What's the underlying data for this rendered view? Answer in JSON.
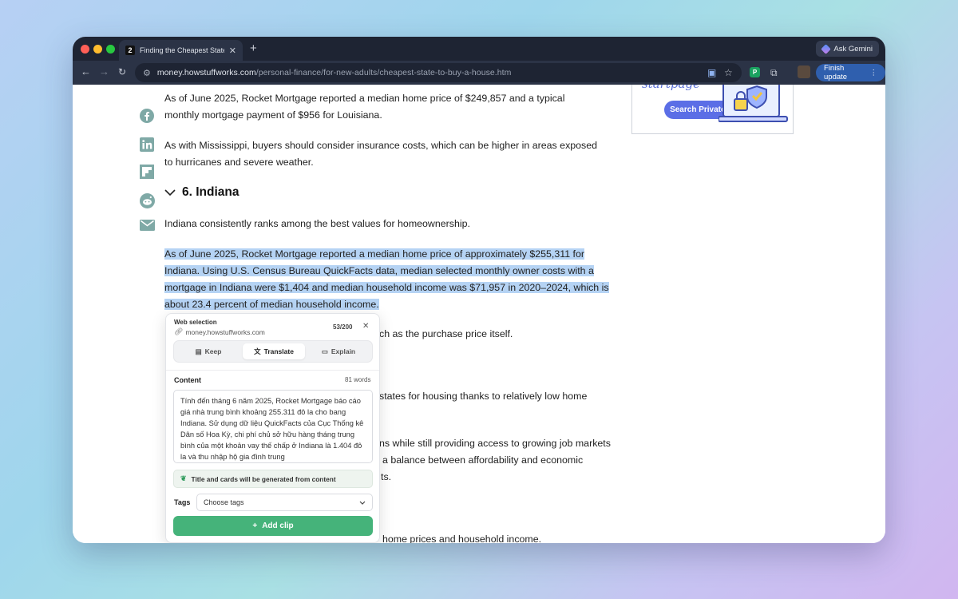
{
  "browser": {
    "tab_title": "Finding the Cheapest State to Buy a House",
    "tab_favicon_letter": "2",
    "url_domain": "money.howstuffworks.com",
    "url_path": "/personal-finance/for-new-adults/cheapest-state-to-buy-a-house.htm",
    "ask_gemini_label": "Ask Gemini",
    "finish_update_label": "Finish update",
    "extension_letter": "P"
  },
  "ad": {
    "brand": "startpage",
    "button_label": "Search Privately"
  },
  "article": {
    "p1": "As of June 2025, Rocket Mortgage reported a median home price of $249,857 and a typical monthly mortgage payment of $956 for Louisiana.",
    "p2": "As with Mississippi, buyers should consider insurance costs, which can be higher in areas exposed to hurricanes and severe weather.",
    "section_heading": "6. Indiana",
    "p3": "Indiana consistently ranks among the best values for homeownership.",
    "selected_lines": [
      "As of June 2025, Rocket Mortgage reported a median home price of approximately $255,311 for",
      "Indiana. Using U.S. Census Bureau QuickFacts data, median selected monthly owner costs with a",
      "mortgage in Indiana were $1,404 and median household income was $71,957 in 2020–2024, which is",
      "about 23.4 percent of median household income."
    ],
    "frag1": "ch as the purchase price itself.",
    "frag2": "states for housing thanks to relatively low home",
    "frag3": "ns while still providing access to growing job markets",
    "frag4": "a balance between affordability and economic",
    "frag5": "ts.",
    "frag6": "home prices and household income."
  },
  "clipper": {
    "header": "Web selection",
    "site": "money.howstuffworks.com",
    "count": "53/200",
    "modes": [
      "Keep",
      "Translate",
      "Explain"
    ],
    "active_mode": "Translate",
    "content_label": "Content",
    "word_count": "81 words",
    "content_text": "Tính đến tháng 6 năm 2025, Rocket Mortgage báo cáo giá nhà trung bình khoảng 255.311 đô la cho bang Indiana. Sử dụng dữ liệu QuickFacts của Cục Thống kê Dân số Hoa Kỳ, chi phí chủ sở hữu hàng tháng trung bình của một khoản vay thế chấp ở Indiana là 1.404 đô la và thu nhập hộ gia đình trung",
    "note": "Title and cards will be generated from content",
    "tags_label": "Tags",
    "tags_placeholder": "Choose tags",
    "add_label": "Add clip"
  },
  "colors": {
    "selection": "#b5d3f4",
    "add_button": "#45b37a",
    "social_icons": "#7fa9a6",
    "finish_update": "#2f5fae"
  }
}
